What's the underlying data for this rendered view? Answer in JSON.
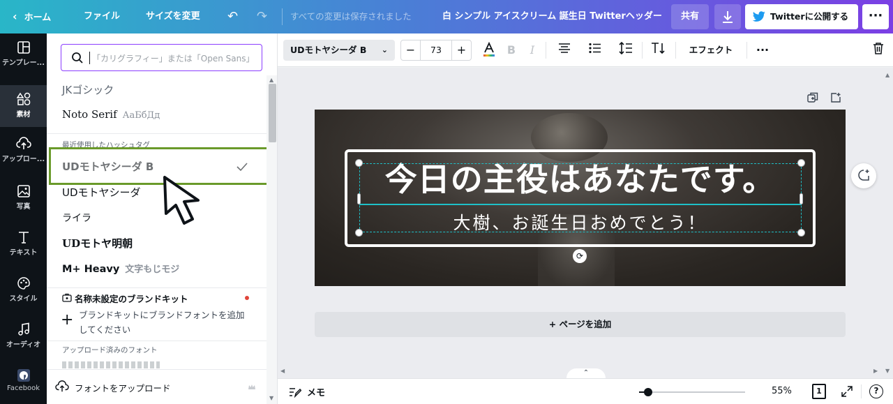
{
  "topbar": {
    "home": "ホーム",
    "file": "ファイル",
    "resize": "サイズを変更",
    "saved_status": "すべての変更は保存されました",
    "doc_title": "白 シンプル アイスクリーム 誕生日 Twitterヘッダー",
    "share": "共有",
    "publish": "Twitterに公開する"
  },
  "rail": {
    "templates": "テンプレー...",
    "elements": "素材",
    "uploads": "アップロー...",
    "photos": "写真",
    "text": "テキスト",
    "styles": "スタイル",
    "audio": "オーディオ",
    "facebook": "Facebook"
  },
  "panel": {
    "search_placeholder": "「カリグラフィー」または「Open Sans」",
    "fonts_top": [
      {
        "name": "JKゴシック",
        "sample": ""
      },
      {
        "name": "Noto Serif",
        "sample": "АаБбДд"
      }
    ],
    "recent_heading": "最近使用したハッシュタグ",
    "recent_fonts": [
      {
        "name": "UDモトヤシーダ B",
        "sample": ""
      },
      {
        "name": "UDモトヤシーダ",
        "sample": ""
      },
      {
        "name": "ライラ",
        "sample": ""
      },
      {
        "name": "UDモトヤ明朝",
        "sample": ""
      },
      {
        "name": "M+ Heavy",
        "sample": "文字もじモジ"
      }
    ],
    "brand_kit_title": "名称未設定のブランドキット",
    "brand_kit_add": "ブランドキットにブランドフォントを追加してください",
    "uploaded_heading": "アップロード済みのフォント",
    "upload_button": "フォントをアップロード"
  },
  "toolbar": {
    "font_name": "UDモトヤシーダ B",
    "font_size": "73",
    "effects": "エフェクト"
  },
  "design": {
    "title": "今日の主役はあなたです。",
    "subtitle": "大樹、お誕生日おめでとう！"
  },
  "canvas": {
    "add_page": "+ ページを追加"
  },
  "bottombar": {
    "memo": "メモ",
    "zoom": "55%",
    "page_count": "1",
    "zoom_level": 0.05
  },
  "colors": {
    "accent": "#8b3dff",
    "selection": "#1ec0c8",
    "highlight_box": "#6a9a2a",
    "twitter": "#1d9bf0"
  }
}
